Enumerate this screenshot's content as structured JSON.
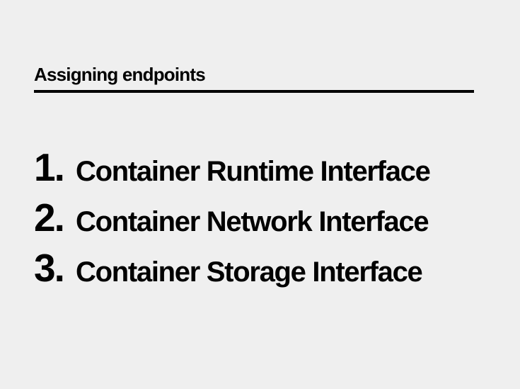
{
  "heading": "Assigning endpoints",
  "items": [
    {
      "number": "1.",
      "label": "Container Runtime Interface"
    },
    {
      "number": "2.",
      "label": "Container Network Interface"
    },
    {
      "number": "3.",
      "label": "Container Storage Interface"
    }
  ],
  "colors": {
    "background": "#efefef",
    "text": "#000000",
    "rule": "#000000"
  }
}
